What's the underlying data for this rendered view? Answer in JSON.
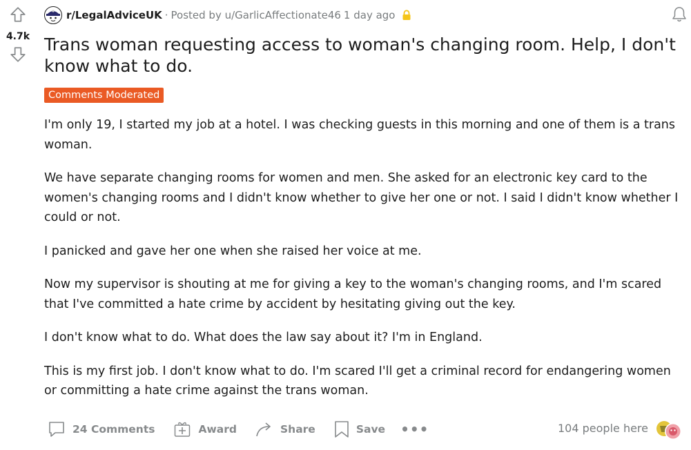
{
  "vote": {
    "score": "4.7k"
  },
  "post": {
    "subreddit": "r/LegalAdviceUK",
    "separator": "·",
    "posted_by": "Posted by u/GarlicAffectionate46",
    "time_ago": "1 day ago",
    "title": "Trans woman requesting access to woman's changing room. Help, I don't know what to do.",
    "flair": "Comments Moderated",
    "paragraphs": [
      "I'm only 19, I started my job at a hotel. I was checking guests in this morning and one of them is a trans woman.",
      "We have separate changing rooms for women and men. She asked for an electronic key card to the women's changing rooms and I didn't know whether to give her one or not. I said I didn't know whether I could or not.",
      "I panicked and gave her one when she raised her voice at me.",
      "Now my supervisor is shouting at me for giving a key to the woman's changing rooms, and I'm scared that I've committed a hate crime by accident by hesitating giving out the key.",
      "I don't know what to do. What does the law say about it? I'm in England.",
      "This is my first job. I don't know what to do. I'm scared I'll get a criminal record for endangering women or committing a hate crime against the trans woman."
    ]
  },
  "actions": {
    "comments": "24 Comments",
    "award": "Award",
    "share": "Share",
    "save": "Save",
    "more": "•••",
    "presence": "104 people here"
  },
  "icons": {
    "upvote": "arrow-up-icon",
    "downvote": "arrow-down-icon",
    "subreddit": "subreddit-avatar-icon",
    "lock": "lock-icon",
    "notification": "bell-icon",
    "comment": "comment-bubble-icon",
    "award": "gift-icon",
    "share": "share-arrow-icon",
    "save": "bookmark-icon"
  },
  "colors": {
    "flair_bg": "#ea5a24",
    "lock": "#f5c518",
    "muted": "#878a8c"
  }
}
